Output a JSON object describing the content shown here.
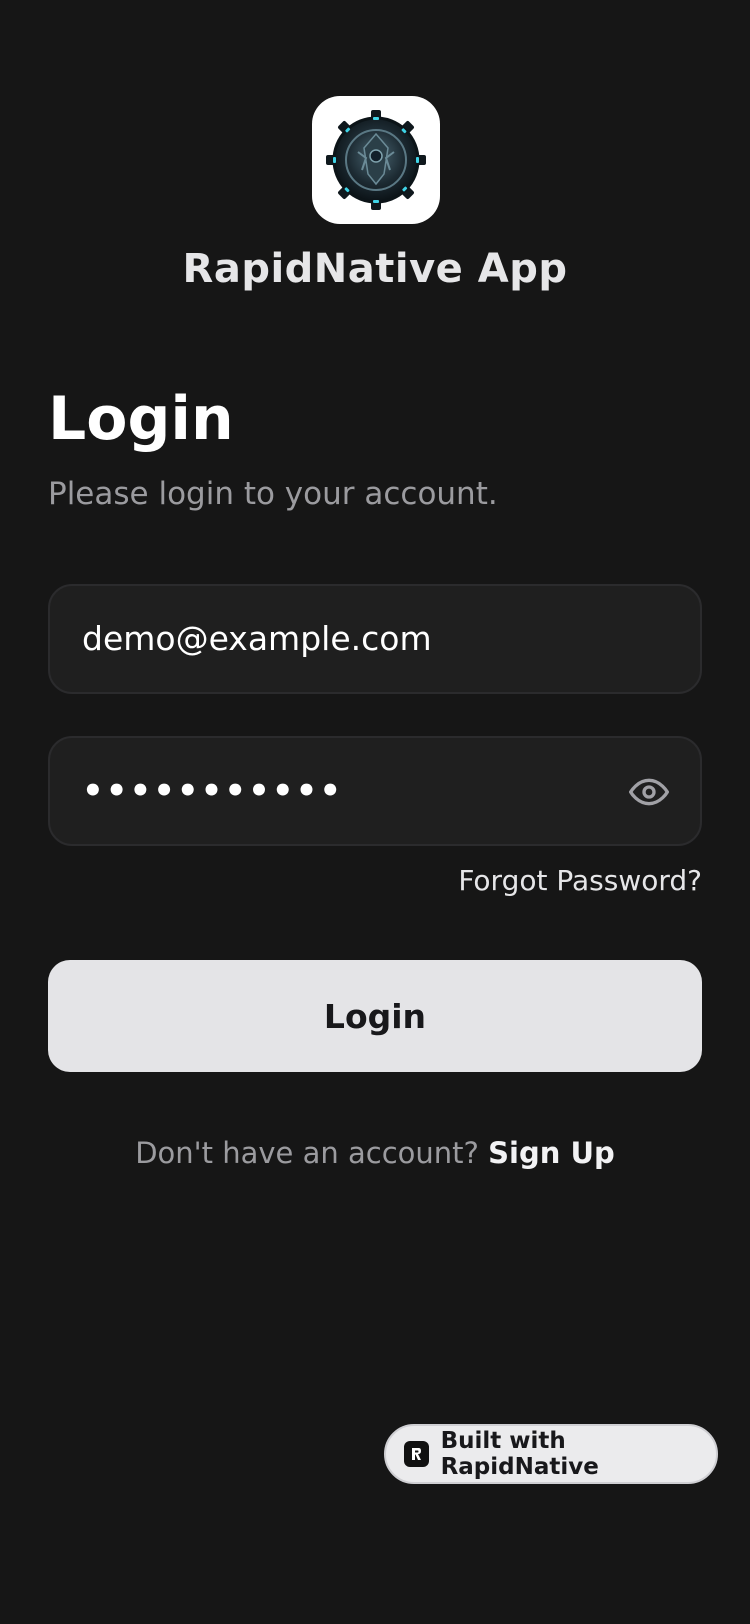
{
  "app": {
    "name": "RapidNative App"
  },
  "header": {
    "title": "Login",
    "subtitle": "Please login to your account."
  },
  "form": {
    "email_value": "demo@example.com",
    "password_masked": "•••••••••••",
    "forgot_password_label": "Forgot Password?",
    "login_button_label": "Login",
    "password_toggle_icon": "eye-icon"
  },
  "signup": {
    "prompt": "Don't have an account?",
    "link_label": "Sign Up"
  },
  "badge": {
    "label": "Built with RapidNative",
    "icon": "rapidnative-logo-icon"
  },
  "colors": {
    "background": "#161616",
    "field_background": "#1f1f1f",
    "button_background": "#e4e4e7",
    "muted_text": "#9b9b9f"
  }
}
